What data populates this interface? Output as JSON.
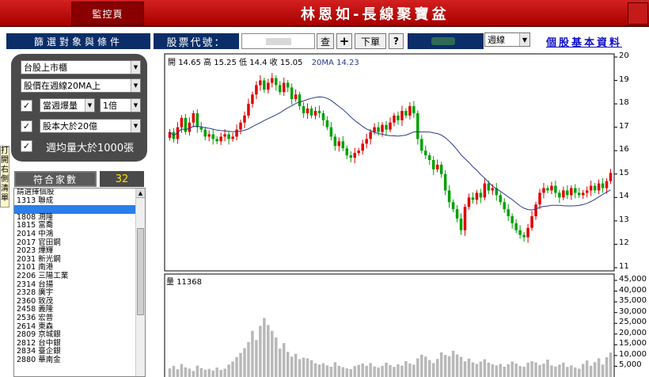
{
  "header": {
    "monitor_tab": "監控頁",
    "app_title": "林恩如-長線聚寶盆"
  },
  "toolbar": {
    "filter_title": "篩選對象與條件",
    "stock_code_label": "股票代號：",
    "search_button": "查",
    "add_button": "+",
    "order_button": "下單",
    "help_button": "?",
    "period_value": "週線",
    "profile_link": "個股基本資料"
  },
  "filters": {
    "market": "台股上市櫃",
    "price_condition": "股價在週線20MA上",
    "volume_condition": "當週爆量",
    "volume_multiplier": "1倍",
    "capital_condition": "股本大於20億",
    "avg_volume_condition": "週均量大於1000張"
  },
  "side_tab": "打開右側清單",
  "results": {
    "count_label": "符合家數",
    "count_value": "32"
  },
  "stock_list": [
    "請選擇個股",
    "1313  聯成",
    "",
    "1808  潤隆",
    "1815  富喬",
    "2014  中鴻",
    "2017  官田鋼",
    "2023  燁輝",
    "2031  新光鋼",
    "2101  南港",
    "2206  三陽工業",
    "2314  台揚",
    "2328  廣宇",
    "2360  致茂",
    "2458  義隆",
    "2536  宏普",
    "2614  東森",
    "2809  京城銀",
    "2812  台中銀",
    "2834  臺企銀",
    "2880  華南金"
  ],
  "chart_ohlc": {
    "open_label": "開",
    "open": "14.65",
    "high_label": "高",
    "high": "15.25",
    "low_label": "低",
    "low": "14.4",
    "close_label": "收",
    "close": "15.05",
    "ma_label": "20MA",
    "ma_value": "14.23"
  },
  "volume_header": {
    "label": "量",
    "value": "11368"
  },
  "chart_data": [
    {
      "type": "candlestick",
      "title": "",
      "xlabel": "",
      "ylabel": "",
      "ylim": [
        11,
        20
      ],
      "yticks": [
        11,
        12,
        13,
        14,
        15,
        16,
        17,
        18,
        19,
        20
      ],
      "ma_series": {
        "name": "20MA",
        "color": "#2a3a8c"
      },
      "up_color": "#e00000",
      "down_color": "#00a000",
      "closes": [
        16.8,
        16.5,
        17.0,
        17.4,
        16.8,
        17.2,
        17.6,
        17.0,
        16.9,
        16.6,
        16.7,
        16.5,
        16.4,
        16.6,
        16.7,
        16.5,
        16.6,
        16.9,
        17.2,
        17.5,
        18.0,
        18.4,
        18.8,
        19.0,
        18.6,
        18.9,
        19.1,
        18.8,
        18.5,
        18.9,
        18.7,
        18.2,
        18.4,
        17.9,
        17.6,
        17.8,
        17.5,
        17.7,
        17.6,
        17.3,
        17.0,
        16.6,
        16.2,
        16.4,
        16.1,
        15.8,
        15.7,
        15.9,
        16.0,
        16.3,
        16.5,
        16.8,
        17.0,
        16.8,
        17.1,
        16.9,
        17.2,
        17.5,
        17.3,
        17.7,
        17.5,
        17.9,
        17.6,
        16.5,
        16.0,
        15.8,
        15.6,
        15.2,
        15.4,
        15.0,
        14.3,
        13.8,
        13.5,
        13.1,
        12.6,
        13.6,
        14.0,
        13.9,
        14.2,
        14.0,
        14.6,
        14.3,
        14.4,
        14.1,
        13.8,
        13.5,
        13.2,
        12.9,
        12.6,
        12.4,
        12.3,
        12.7,
        13.2,
        13.7,
        14.2,
        14.4,
        14.3,
        14.5,
        14.2,
        14.0,
        14.3,
        14.1,
        14.4,
        14.2,
        14.1,
        14.2,
        14.3,
        14.5,
        14.3,
        14.6,
        14.4,
        14.7,
        15.05
      ]
    },
    {
      "type": "bar",
      "title": "",
      "ylabel": "",
      "ylim": [
        0,
        45000
      ],
      "yticks": [
        5000,
        10000,
        15000,
        20000,
        25000,
        30000,
        35000,
        40000,
        45000
      ],
      "color": "#b8b8b8",
      "values": [
        4000,
        5200,
        3600,
        6100,
        4500,
        3900,
        2800,
        5300,
        4100,
        3400,
        3800,
        3000,
        4400,
        3300,
        3900,
        5800,
        7200,
        9300,
        11200,
        13400,
        16300,
        21500,
        17200,
        23800,
        27500,
        24200,
        21500,
        18400,
        13200,
        15800,
        11700,
        9500,
        10800,
        8300,
        9000,
        8700,
        7800,
        6400,
        5800,
        6400,
        5400,
        4800,
        6900,
        5200,
        4600,
        4000,
        3700,
        5100,
        5700,
        6300,
        5200,
        6500,
        4900,
        4400,
        5200,
        6700,
        5600,
        4700,
        5900,
        5300,
        7400,
        6300,
        5800,
        8700,
        10400,
        9500,
        7900,
        6500,
        8400,
        11500,
        10300,
        9700,
        12200,
        10500,
        9400,
        7300,
        8600,
        6800,
        6100,
        7200,
        8300,
        6700,
        5900,
        5400,
        6100,
        4800,
        5900,
        7200,
        6300,
        5100,
        4800,
        6700,
        7400,
        6800,
        5600,
        6200,
        8100,
        5400,
        4900,
        5800,
        6700,
        4700,
        5400,
        4400,
        3900,
        6100,
        7700,
        5200,
        6900,
        8700,
        5800,
        9200,
        11368
      ]
    }
  ]
}
